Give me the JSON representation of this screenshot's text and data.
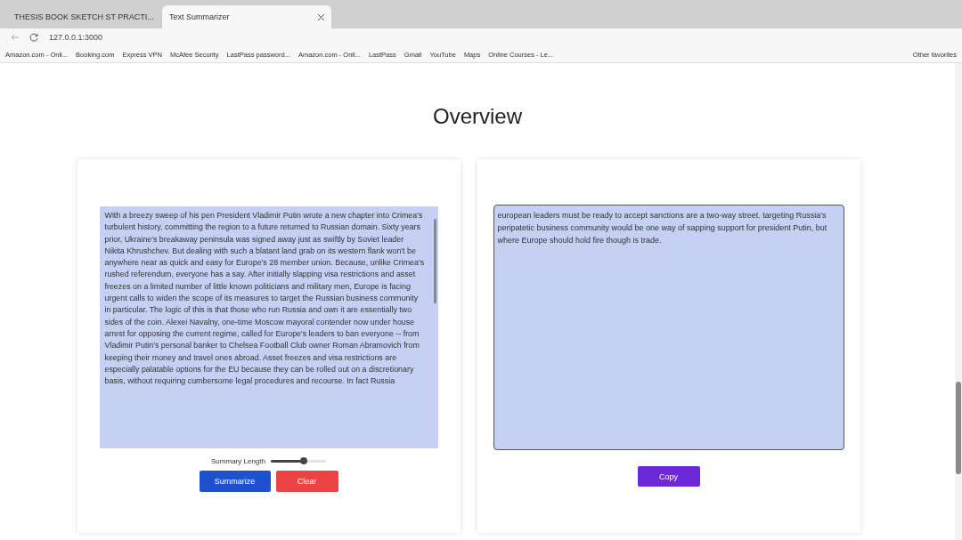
{
  "browser": {
    "tabs": [
      {
        "title": "THESIS BOOK SKETCH ST PRACTI...",
        "selected": false
      },
      {
        "title": "Text Summarizer",
        "selected": true
      }
    ],
    "address": "127.0.0.1:3000",
    "bookmarks": [
      {
        "label": "Amazon.com - Onli..."
      },
      {
        "label": "Booking.com"
      },
      {
        "label": "Express VPN"
      },
      {
        "label": "McAfee Security"
      },
      {
        "label": "LastPass password..."
      },
      {
        "label": "Amazon.com - Onli..."
      },
      {
        "label": "LastPass"
      },
      {
        "label": "Gmail"
      },
      {
        "label": "YouTube"
      },
      {
        "label": "Maps"
      },
      {
        "label": "Online Courses - Le..."
      }
    ],
    "other_favorites": "Other favorites"
  },
  "page": {
    "title": "Overview",
    "input_text": "With a breezy sweep of his pen President Vladimir Putin wrote a new chapter into Crimea's turbulent history, committing the region to a future returned to Russian domain. Sixty years prior, Ukraine's breakaway peninsula was signed away just as swiftly by Soviet leader Nikita Khrushchev. But dealing with such a blatant land grab on its western flank won't be anywhere near as quick and easy for Europe's 28 member union. Because, unlike Crimea's rushed referendum, everyone has a say. After initially slapping visa restrictions and asset freezes on a limited number of little known politicians and military men, Europe is facing urgent calls to widen the scope of its measures to target the Russian business community in particular. The logic of this is that those who run Russia and own it are essentially two sides of the coin. Alexei Navalny, one-time Moscow mayoral contender now under house arrest for opposing the current regime, called for Europe's leaders to ban everyone -- from Vladimir Putin's personal banker to Chelsea Football Club owner Roman Abramovich from keeping their money and travel ones abroad. Asset freezes and visa restrictions are especially palatable options for the EU because they can be rolled out on a discretionary basis, without requiring cumbersome legal procedures and recourse. In fact Russia",
    "summary_length": {
      "label": "Summary Length",
      "level": 0.6
    },
    "buttons": [
      {
        "label": "Summarize",
        "kind": "primary"
      },
      {
        "label": "Clear",
        "kind": "danger"
      }
    ],
    "output_text": "european leaders must be ready to accept sanctions are a two-way street. targeting Russia's peripatetic business community would be one way of sapping support for president Putin, but where Europe should hold fire though is trade.",
    "copy_button": "Copy"
  }
}
